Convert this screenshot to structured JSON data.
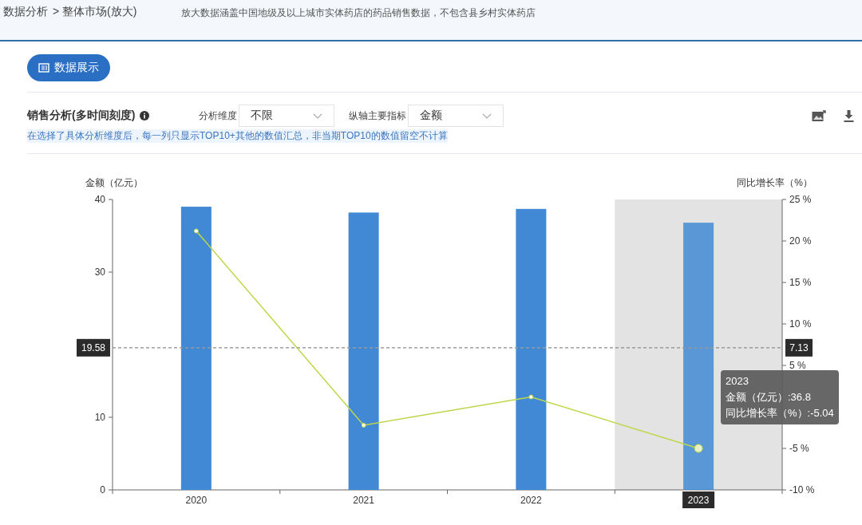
{
  "breadcrumb": {
    "items": [
      "数据分析",
      "> 整体市场(放大)"
    ],
    "notice": "放大数据涵盖中国地级及以上城市实体药店的药品销售数据，不包含县乡村实体药店"
  },
  "display_button": {
    "label": "数据展示"
  },
  "section": {
    "title": "销售分析(多时间刻度)",
    "filters": [
      {
        "label": "分析维度",
        "value": "不限"
      },
      {
        "label": "纵轴主要指标",
        "value": "金额"
      }
    ],
    "note": "在选择了具体分析维度后，每一列只显示TOP10+其他的数值汇总，非当期TOP10的数值留空不计算"
  },
  "chart": {
    "chart_data": {
      "type": "bar",
      "ylabel": "金额（亿元）",
      "categories": [
        "2020",
        "2021",
        "2022",
        "2023"
      ],
      "series": [
        {
          "color": "#4189d4",
          "values": [
            39.0,
            38.2,
            38.7,
            36.8
          ]
        }
      ],
      "ylim": [
        0,
        40
      ],
      "yticks": [
        0,
        10,
        30,
        40
      ],
      "ref_lines": [
        {
          "axis": "y",
          "value": 19.58,
          "label": "19.58"
        }
      ]
    },
    "x_states": [
      {
        "selected": false
      },
      {
        "selected": false
      },
      {
        "selected": false
      },
      {
        "selected": true
      }
    ],
    "overlay": {
      "chart_data": {
        "type": "line",
        "ylabel": "同比增长率（%）",
        "categories": [
          null,
          null,
          null,
          null
        ],
        "series": [
          {
            "color": "#bfd64a",
            "marker": "circle",
            "values": [
              21.2,
              -2.2,
              1.2,
              -5.0
            ]
          }
        ],
        "ylim": [
          -10,
          25
        ],
        "yticks": [
          {
            "value": -10,
            "label": "-10 %"
          },
          {
            "value": -5,
            "label": "-5 %"
          },
          {
            "value": 5,
            "label": "5 %"
          },
          {
            "value": 10,
            "label": "10 %"
          },
          {
            "value": 15,
            "label": "15 %"
          },
          {
            "value": 20,
            "label": "20 %"
          },
          {
            "value": 25,
            "label": "25 %"
          }
        ],
        "ref_lines": [
          {
            "axis": "y",
            "value": 7.13,
            "label": "7.13"
          }
        ]
      }
    },
    "tooltip": {
      "title": "2023",
      "lines": [
        "金额（亿元）:36.8",
        "同比增长率（%）:-5.04"
      ]
    }
  }
}
